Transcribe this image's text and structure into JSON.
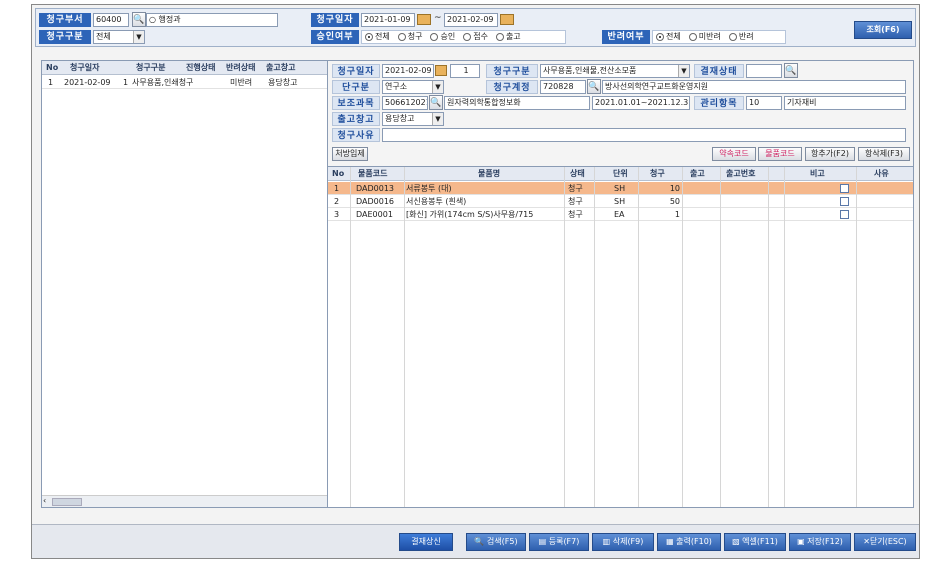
{
  "top": {
    "dept_label": "청구부서",
    "dept_code": "60400",
    "dept_name": "○ 행정과",
    "req_type_label": "청구구분",
    "req_type_value": "전체",
    "req_date_label": "청구일자",
    "date_from": "2021-01-09",
    "date_sep": "~",
    "date_to": "2021-02-09",
    "approval_label": "승인여부",
    "approval_options": [
      "전체",
      "청구",
      "승인",
      "접수",
      "출고"
    ],
    "approval_selected": 0,
    "return_label": "반려여부",
    "return_options": [
      "전체",
      "미반려",
      "반려"
    ],
    "return_selected": 0,
    "search_button": "조회(F6)"
  },
  "left_grid": {
    "headers": [
      "No",
      "청구일자",
      "청구구분",
      "진행상태",
      "반려상태",
      "출고창고"
    ],
    "rows": [
      {
        "no": "1",
        "date": "2021-02-09",
        "num": "1",
        "type": "사무용품,인쇄청구",
        "status": "",
        "reject": "미반려",
        "warehouse": "용당창고"
      }
    ]
  },
  "detail": {
    "req_date_label": "청구일자",
    "req_date": "2021-02-09",
    "seq": "1",
    "req_type_label": "청구구분",
    "req_type": "사무용품,인쇄물,전산소모품",
    "pay_status_label": "결재상태",
    "pay_status": "",
    "unit_label": "단구분",
    "unit_value": "연구소",
    "account_label": "청구계정",
    "account_code": "720828",
    "account_name": "방사선의학연구교트화운영지원",
    "subject_label": "보조과목",
    "subject_code": "506612021",
    "subject_name": "원자력의학통합정보화",
    "period": "2021.01.01~2021.12.31",
    "mgmt_label": "관리항목",
    "mgmt_code": "10",
    "mgmt_name": "기자재비",
    "warehouse_label": "출고창고",
    "warehouse_value": "용당창고",
    "reason_label": "청구사유",
    "reason_value": ""
  },
  "detail_buttons": {
    "batch_input": "처방입제",
    "short_code": "약속코드",
    "item_code": "물품코드",
    "add_row": "항추가(F2)",
    "del_row": "항삭제(F3)"
  },
  "items": {
    "headers": [
      "No",
      "물품코드",
      "물품명",
      "상태",
      "단위",
      "청구",
      "출고",
      "출고번호",
      "비고",
      "사유"
    ],
    "rows": [
      {
        "no": "1",
        "code": "DAD0013",
        "name": "서류봉투 (대)",
        "status": "청구",
        "unit": "SH",
        "qty": "10",
        "out": "",
        "outno": "",
        "note": "",
        "reason": ""
      },
      {
        "no": "2",
        "code": "DAD0016",
        "name": "서신용봉투 (흰색)",
        "status": "청구",
        "unit": "SH",
        "qty": "50",
        "out": "",
        "outno": "",
        "note": "",
        "reason": ""
      },
      {
        "no": "3",
        "code": "DAE0001",
        "name": "[화신] 가위(174cm S/S)사무용/715",
        "status": "청구",
        "unit": "EA",
        "qty": "1",
        "out": "",
        "outno": "",
        "note": "",
        "reason": ""
      }
    ]
  },
  "bottom": {
    "approval_request": "결재상신",
    "search": "검색(F5)",
    "register": "등록(F7)",
    "delete": "삭제(F9)",
    "print": "출력(F10)",
    "excel": "엑셀(F11)",
    "save": "저장(F12)",
    "close": "닫기(ESC)"
  },
  "colors": {
    "label_blue": "#2d64b8",
    "selected_row": "#f5b88c",
    "bottom_btn": "#2e5fae"
  }
}
